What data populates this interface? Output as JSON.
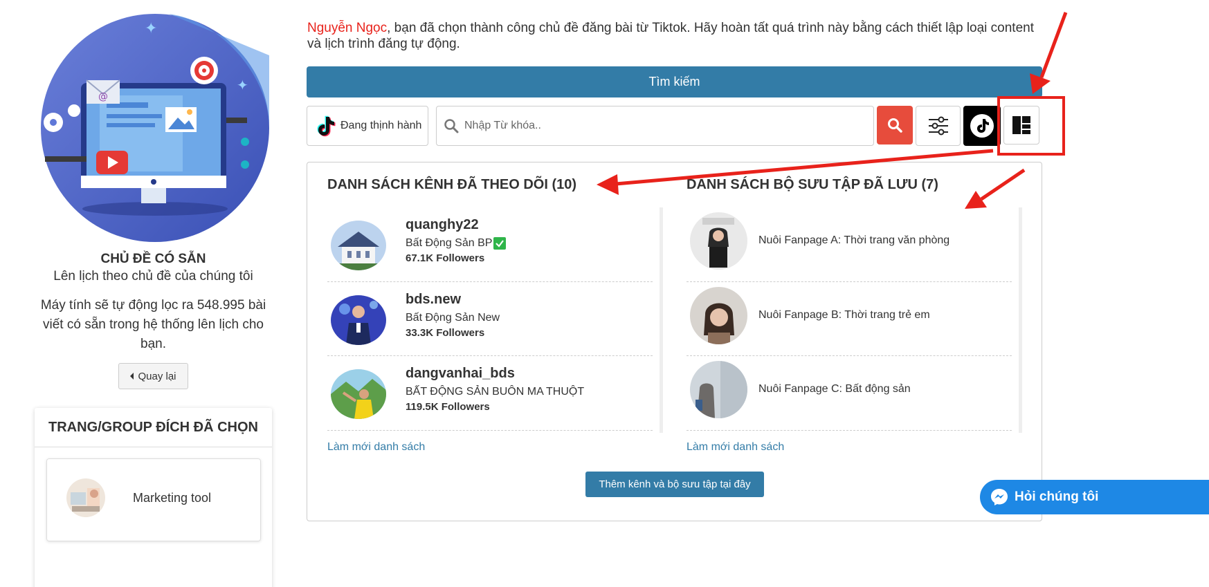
{
  "intro": {
    "user_name": "Nguyễn Ngọc",
    "message": ", bạn đã chọn thành công chủ đề đăng bài từ Tiktok. Hãy hoàn tất quá trình này bằng cách thiết lập loại content và lịch trình đăng tự động."
  },
  "left": {
    "topic_title": "CHỦ ĐỀ CÓ SẴN",
    "topic_subtitle": "Lên lịch theo chủ đề của chúng tôi",
    "topic_description": "Máy tính sẽ tự động lọc ra 548.995 bài viết có sẵn trong hệ thống lên lịch cho bạn.",
    "back_label": "Quay lại",
    "target_panel_title": "TRANG/GROUP ĐÍCH ĐÃ CHỌN",
    "target_name": "Marketing tool"
  },
  "toolbar": {
    "search_button_label": "Tìm kiếm",
    "trending_label": "Đang thịnh hành",
    "search_placeholder": "Nhập Từ khóa.."
  },
  "channels": {
    "title": "DANH SÁCH KÊNH ĐÃ THEO DÕI (10)",
    "items": [
      {
        "handle": "quanghy22",
        "desc": "Bất Động Sản BP",
        "verified": true,
        "followers": "67.1K Followers"
      },
      {
        "handle": "bds.new",
        "desc": "Bất Động Sản New",
        "verified": false,
        "followers": "33.3K Followers"
      },
      {
        "handle": "dangvanhai_bds",
        "desc": "BẤT ĐỘNG SẢN BUÔN MA THUỘT",
        "verified": false,
        "followers": "119.5K Followers"
      }
    ],
    "refresh_label": "Làm mới danh sách"
  },
  "collections": {
    "title": "DANH SÁCH BỘ SƯU TẬP ĐÃ LƯU (7)",
    "items": [
      {
        "name": "Nuôi Fanpage A: Thời trang văn phòng"
      },
      {
        "name": "Nuôi Fanpage B: Thời trang trẻ em"
      },
      {
        "name": "Nuôi Fanpage C: Bất động sản"
      }
    ],
    "refresh_label": "Làm mới danh sách"
  },
  "add_button_label": "Thêm kênh và bộ sưu tập tại đây",
  "chat_label": "Hỏi chúng tôi",
  "colors": {
    "primary": "#337ca7",
    "danger": "#e74c3c",
    "annotation": "#e8221b",
    "messenger": "#1e88e5"
  }
}
